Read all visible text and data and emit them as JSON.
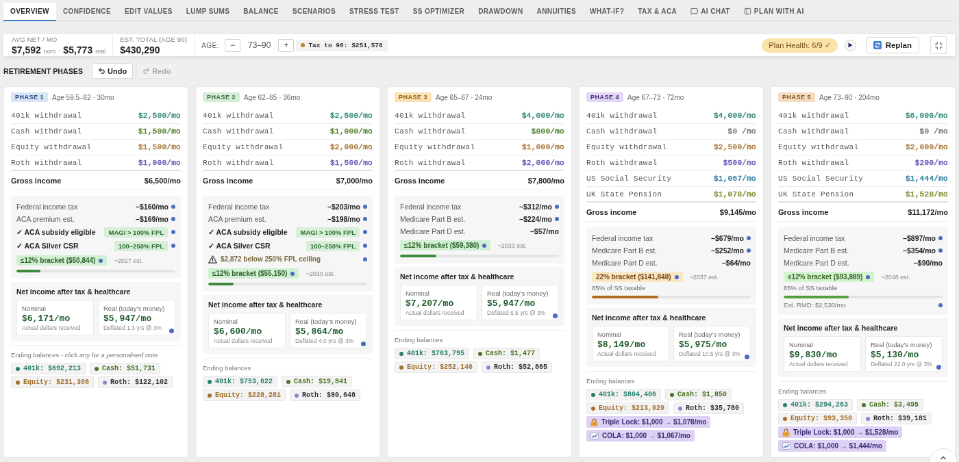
{
  "tabs": [
    {
      "label": "OVERVIEW",
      "selected": true,
      "kind": "plain"
    },
    {
      "label": "CONFIDENCE",
      "selected": false,
      "kind": "plain"
    },
    {
      "label": "EDIT VALUES",
      "selected": false,
      "kind": "plain"
    },
    {
      "label": "LUMP SUMS",
      "selected": false,
      "kind": "plain"
    },
    {
      "label": "BALANCE",
      "selected": false,
      "kind": "plain"
    },
    {
      "label": "SCENARIOS",
      "selected": false,
      "kind": "plain"
    },
    {
      "label": "STRESS TEST",
      "selected": false,
      "kind": "plain"
    },
    {
      "label": "SS OPTIMIZER",
      "selected": false,
      "kind": "plain"
    },
    {
      "label": "DRAWDOWN",
      "selected": false,
      "kind": "plain"
    },
    {
      "label": "ANNUITIES",
      "selected": false,
      "kind": "plain"
    },
    {
      "label": "WHAT-IF?",
      "selected": false,
      "kind": "plain"
    },
    {
      "label": "TAX & ACA",
      "selected": false,
      "kind": "plain"
    },
    {
      "label": "AI CHAT",
      "selected": false,
      "kind": "chat"
    },
    {
      "label": "PLAN WITH AI",
      "selected": false,
      "kind": "sidebar"
    }
  ],
  "summary": {
    "avg_net": {
      "label": "AVG NET / MO",
      "nominal": "$7,592",
      "nominal_unit": "nom",
      "separator": "·",
      "real": "$5,773",
      "real_unit": "real"
    },
    "est_total": {
      "label": "EST. TOTAL (AGE 90)",
      "value": "$430,290"
    },
    "age": {
      "label": "AGE:",
      "decrement": "−",
      "range": "73–90",
      "increment": "+"
    },
    "tax_to_90": {
      "text": "Tax to 90: $251,576",
      "color": "#c0822a"
    },
    "plan_health": "Plan Health: 6/9 ✓",
    "replan": "Replan"
  },
  "section": {
    "title": "RETIREMENT PHASES",
    "undo": {
      "label": "Undo",
      "disabled": false
    },
    "redo": {
      "label": "Redo",
      "disabled": true
    }
  },
  "phases": [
    {
      "badge": "PHASE 1",
      "color": "#d9e4f6",
      "ages": "Age 59.5–62 · 30mo",
      "income": [
        {
          "label": "401k withdrawal",
          "value": "$2,500/mo",
          "color": "#2e8a78"
        },
        {
          "label": "Cash withdrawal",
          "value": "$1,500/mo",
          "color": "#4e7f2a"
        },
        {
          "label": "Equity withdrawal",
          "value": "$1,500/mo",
          "color": "#a8783a"
        },
        {
          "label": "Roth withdrawal",
          "value": "$1,000/mo",
          "color": "#6a5ab8"
        }
      ],
      "gross": {
        "label": "Gross income",
        "value": "$6,500/mo"
      },
      "tax": [
        {
          "kind": "line",
          "label": "Federal income tax",
          "value": "−$160/mo",
          "dot": true
        },
        {
          "kind": "line",
          "label": "ACA premium est.",
          "value": "−$169/mo",
          "dot": true
        },
        {
          "kind": "check",
          "label": "✓ ACA subsidy eligible",
          "tag": "MAGI > 100% FPL",
          "dot": true
        },
        {
          "kind": "check",
          "label": "✓ ACA Silver CSR",
          "tag": "100–250% FPL",
          "dot": true
        }
      ],
      "bracket": {
        "label": "≤12% bracket ($50,844)",
        "dot": true,
        "note": "~2027 est.",
        "color": "#3f8a3a",
        "level": 0.15
      },
      "net": {
        "title": "Net income after tax & healthcare",
        "nominal": {
          "label": "Nominal",
          "value": "$6,171/mo",
          "note": "Actual dollars received"
        },
        "real": {
          "label": "Real (today's money)",
          "value": "$5,947/mo",
          "note": "Deflated 1.3 yrs @ 3%"
        },
        "dot": true
      },
      "balances": {
        "title": "Ending balances - *click any for a personalised note*",
        "chips": [
          {
            "text": "401k: $692,213",
            "color": "#2a7f6e",
            "kind": "tinted"
          },
          {
            "text": "Cash: $51,731",
            "color": "#4a7426",
            "kind": "tinted"
          },
          {
            "text": "Equity: $231,308",
            "color": "#a2702f",
            "kind": "tinted"
          },
          {
            "text": "Roth: $122,102",
            "color": "#8b84d0",
            "kind": "plain"
          }
        ]
      }
    },
    {
      "badge": "PHASE 2",
      "color": "#d5ecd6",
      "ages": "Age 62–65 · 36mo",
      "income": [
        {
          "label": "401k withdrawal",
          "value": "$2,500/mo",
          "color": "#2e8a78"
        },
        {
          "label": "Cash withdrawal",
          "value": "$1,000/mo",
          "color": "#4e7f2a"
        },
        {
          "label": "Equity withdrawal",
          "value": "$2,000/mo",
          "color": "#a8783a"
        },
        {
          "label": "Roth withdrawal",
          "value": "$1,500/mo",
          "color": "#6a5ab8"
        }
      ],
      "gross": {
        "label": "Gross income",
        "value": "$7,000/mo"
      },
      "tax": [
        {
          "kind": "line",
          "label": "Federal income tax",
          "value": "−$203/mo",
          "dot": true
        },
        {
          "kind": "line",
          "label": "ACA premium est.",
          "value": "−$198/mo",
          "dot": true
        },
        {
          "kind": "check",
          "label": "✓ ACA subsidy eligible",
          "tag": "MAGI > 100% FPL",
          "dot": true
        },
        {
          "kind": "check",
          "label": "✓ ACA Silver CSR",
          "tag": "100–250% FPL",
          "dot": true
        },
        {
          "kind": "warning",
          "label": "$2,872 below 250% FPL ceiling",
          "dot": true
        }
      ],
      "bracket": {
        "label": "≤12% bracket ($55,150)",
        "dot": true,
        "note": "~2030 est.",
        "color": "#3f8a3a",
        "level": 0.16
      },
      "net": {
        "title": "Net income after tax & healthcare",
        "nominal": {
          "label": "Nominal",
          "value": "$6,600/mo",
          "note": "Actual dollars received"
        },
        "real": {
          "label": "Real (today's money)",
          "value": "$5,864/mo",
          "note": "Deflated 4.0 yrs @ 3%"
        },
        "dot": true
      },
      "balances": {
        "title": "Ending balances",
        "chips": [
          {
            "text": "401k: $753,622",
            "color": "#2a7f6e",
            "kind": "tinted"
          },
          {
            "text": "Cash: $19,841",
            "color": "#4a7426",
            "kind": "tinted"
          },
          {
            "text": "Equity: $228,281",
            "color": "#a2702f",
            "kind": "tinted"
          },
          {
            "text": "Roth: $90,648",
            "color": "#8b84d0",
            "kind": "plain"
          }
        ]
      }
    },
    {
      "badge": "PHASE 3",
      "color": "#fbe2b4",
      "ages": "Age 65–67 · 24mo",
      "income": [
        {
          "label": "401k withdrawal",
          "value": "$4,000/mo",
          "color": "#2e8a78"
        },
        {
          "label": "Cash withdrawal",
          "value": "$800/mo",
          "color": "#4e7f2a"
        },
        {
          "label": "Equity withdrawal",
          "value": "$1,000/mo",
          "color": "#a8783a"
        },
        {
          "label": "Roth withdrawal",
          "value": "$2,000/mo",
          "color": "#6a5ab8"
        }
      ],
      "gross": {
        "label": "Gross income",
        "value": "$7,800/mo"
      },
      "tax": [
        {
          "kind": "line",
          "label": "Federal income tax",
          "value": "−$312/mo",
          "dot": true
        },
        {
          "kind": "line",
          "label": "Medicare Part B est.",
          "value": "−$224/mo",
          "dot": true
        },
        {
          "kind": "line",
          "label": "Medicare Part D est.",
          "value": "−$57/mo",
          "dot": false
        }
      ],
      "bracket": {
        "label": "≤12% bracket ($59,380)",
        "dot": true,
        "note": "~2033 est.",
        "color": "#3f8a3a",
        "level": 0.23
      },
      "net": {
        "title": "Net income after tax & healthcare",
        "nominal": {
          "label": "Nominal",
          "value": "$7,207/mo",
          "note": "Actual dollars received"
        },
        "real": {
          "label": "Real (today's money)",
          "value": "$5,947/mo",
          "note": "Deflated 6.5 yrs @ 3%"
        },
        "dot": true
      },
      "balances": {
        "title": "Ending balances",
        "chips": [
          {
            "text": "401k: $763,795",
            "color": "#2a7f6e",
            "kind": "tinted"
          },
          {
            "text": "Cash: $1,477",
            "color": "#4a7426",
            "kind": "tinted"
          },
          {
            "text": "Equity: $252,146",
            "color": "#a2702f",
            "kind": "tinted"
          },
          {
            "text": "Roth: $52,865",
            "color": "#8b84d0",
            "kind": "plain"
          }
        ]
      }
    },
    {
      "badge": "PHASE 4",
      "color": "#e2d8f6",
      "ages": "Age 67–73 · 72mo",
      "income": [
        {
          "label": "401k withdrawal",
          "value": "$4,000/mo",
          "color": "#2e8a78"
        },
        {
          "label": "Cash withdrawal",
          "value": "$0 /mo",
          "color": "#777777"
        },
        {
          "label": "Equity withdrawal",
          "value": "$2,500/mo",
          "color": "#a8783a"
        },
        {
          "label": "Roth withdrawal",
          "value": "$500/mo",
          "color": "#6a5ab8"
        },
        {
          "label": "US Social Security",
          "value": "$1,067/mo",
          "color": "#2a7fa0"
        },
        {
          "label": "UK State Pension",
          "value": "$1,078/mo",
          "color": "#7f8a2a"
        }
      ],
      "gross": {
        "label": "Gross income",
        "value": "$9,145/mo"
      },
      "tax": [
        {
          "kind": "line",
          "label": "Federal income tax",
          "value": "−$679/mo",
          "dot": true
        },
        {
          "kind": "line",
          "label": "Medicare Part B est.",
          "value": "−$252/mo",
          "dot": true
        },
        {
          "kind": "line",
          "label": "Medicare Part D est.",
          "value": "−$64/mo",
          "dot": false
        }
      ],
      "bracket": {
        "label": "22% bracket ($141,848)",
        "dot": true,
        "note": "~2037 est.",
        "caption": "85% of SS taxable",
        "color": "#b06d1e",
        "level": 0.42
      },
      "net": {
        "title": "Net income after tax & healthcare",
        "nominal": {
          "label": "Nominal",
          "value": "$8,149/mo",
          "note": "Actual dollars received"
        },
        "real": {
          "label": "Real (today's money)",
          "value": "$5,975/mo",
          "note": "Deflated 10.5 yrs @ 3%"
        },
        "dot": true
      },
      "balances": {
        "title": "Ending balances",
        "chips": [
          {
            "text": "401k: $804,406",
            "color": "#2a7f6e",
            "kind": "tinted"
          },
          {
            "text": "Cash: $1,850",
            "color": "#4a7426",
            "kind": "tinted"
          },
          {
            "text": "Equity: $213,020",
            "color": "#a2702f",
            "kind": "tinted"
          },
          {
            "text": "Roth: $35,780",
            "color": "#8b84d0",
            "kind": "plain"
          }
        ],
        "notes": [
          {
            "kind": "lock",
            "text": "Triple Lock: $1,000 → $1,078/mo"
          },
          {
            "kind": "chart",
            "text": "COLA: $1,000 → $1,067/mo"
          }
        ]
      }
    },
    {
      "badge": "PHASE 5",
      "color": "#f4dcc0",
      "ages": "Age 73–90 · 204mo",
      "income": [
        {
          "label": "401k withdrawal",
          "value": "$6,000/mo",
          "color": "#2e8a78"
        },
        {
          "label": "Cash withdrawal",
          "value": "$0 /mo",
          "color": "#777777"
        },
        {
          "label": "Equity withdrawal",
          "value": "$2,000/mo",
          "color": "#a8783a"
        },
        {
          "label": "Roth withdrawal",
          "value": "$200/mo",
          "color": "#6a5ab8"
        },
        {
          "label": "US Social Security",
          "value": "$1,444/mo",
          "color": "#2a7fa0"
        },
        {
          "label": "UK State Pension",
          "value": "$1,528/mo",
          "color": "#7f8a2a"
        }
      ],
      "gross": {
        "label": "Gross income",
        "value": "$11,172/mo"
      },
      "tax": [
        {
          "kind": "line",
          "label": "Federal income tax",
          "value": "−$897/mo",
          "dot": true
        },
        {
          "kind": "line",
          "label": "Medicare Part B est.",
          "value": "−$354/mo",
          "dot": true
        },
        {
          "kind": "line",
          "label": "Medicare Part D est.",
          "value": "−$90/mo",
          "dot": false
        }
      ],
      "bracket": {
        "label": "≤12% bracket ($93,889)",
        "dot": true,
        "note": "~2048 est.",
        "caption": "85% of SS taxable",
        "color": "#55a03a",
        "level": 0.41,
        "footnote": {
          "text": "Est. RMD: $2,530/mo",
          "dot": true
        }
      },
      "net": {
        "title": "Net income after tax & healthcare",
        "nominal": {
          "label": "Nominal",
          "value": "$9,830/mo",
          "note": "Actual dollars received"
        },
        "real": {
          "label": "Real (today's money)",
          "value": "$5,130/mo",
          "note": "Deflated 22.0 yrs @ 3%"
        },
        "dot": true
      },
      "balances": {
        "title": "Ending balances",
        "chips": [
          {
            "text": "401k: $294,263",
            "color": "#2a7f6e",
            "kind": "tinted"
          },
          {
            "text": "Cash: $3,495",
            "color": "#4a7426",
            "kind": "tinted"
          },
          {
            "text": "Equity: $93,350",
            "color": "#a2702f",
            "kind": "tinted"
          },
          {
            "text": "Roth: $39,181",
            "color": "#8b84d0",
            "kind": "plain"
          }
        ],
        "notes": [
          {
            "kind": "lock",
            "text": "Triple Lock: $1,000 → $1,528/mo"
          },
          {
            "kind": "chart",
            "text": "COLA: $1,000 → $1,444/mo"
          }
        ]
      }
    }
  ]
}
